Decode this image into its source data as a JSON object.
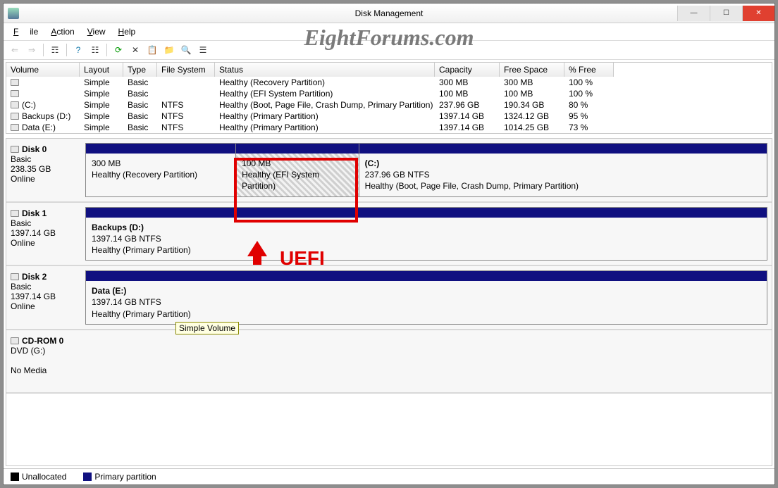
{
  "window": {
    "title": "Disk Management"
  },
  "watermark": "EightForums.com",
  "menu": {
    "file": "File",
    "action": "Action",
    "view": "View",
    "help": "Help"
  },
  "toolbar_icons": [
    "back",
    "forward",
    "up",
    "properties",
    "tree",
    "refresh",
    "delete",
    "create",
    "format",
    "connect",
    "help-bubble",
    "list"
  ],
  "columns": {
    "volume": "Volume",
    "layout": "Layout",
    "type": "Type",
    "fs": "File System",
    "status": "Status",
    "capacity": "Capacity",
    "free": "Free Space",
    "pct": "% Free"
  },
  "volumes": [
    {
      "name": "",
      "layout": "Simple",
      "type": "Basic",
      "fs": "",
      "status": "Healthy (Recovery Partition)",
      "cap": "300 MB",
      "free": "300 MB",
      "pct": "100 %"
    },
    {
      "name": "",
      "layout": "Simple",
      "type": "Basic",
      "fs": "",
      "status": "Healthy (EFI System Partition)",
      "cap": "100 MB",
      "free": "100 MB",
      "pct": "100 %"
    },
    {
      "name": "(C:)",
      "layout": "Simple",
      "type": "Basic",
      "fs": "NTFS",
      "status": "Healthy (Boot, Page File, Crash Dump, Primary Partition)",
      "cap": "237.96 GB",
      "free": "190.34 GB",
      "pct": "80 %"
    },
    {
      "name": "Backups (D:)",
      "layout": "Simple",
      "type": "Basic",
      "fs": "NTFS",
      "status": "Healthy (Primary Partition)",
      "cap": "1397.14 GB",
      "free": "1324.12 GB",
      "pct": "95 %"
    },
    {
      "name": "Data (E:)",
      "layout": "Simple",
      "type": "Basic",
      "fs": "NTFS",
      "status": "Healthy (Primary Partition)",
      "cap": "1397.14 GB",
      "free": "1014.25 GB",
      "pct": "73 %"
    }
  ],
  "disks": [
    {
      "label": "Disk 0",
      "type": "Basic",
      "size": "238.35 GB",
      "state": "Online",
      "parts": [
        {
          "title": "",
          "line1": "300 MB",
          "line2": "Healthy (Recovery Partition)",
          "w": "22"
        },
        {
          "title": "",
          "line1": "100 MB",
          "line2": "Healthy (EFI System Partition)",
          "w": "18",
          "hatch": true
        },
        {
          "title": "(C:)",
          "line1": "237.96 GB NTFS",
          "line2": "Healthy (Boot, Page File, Crash Dump, Primary Partition)",
          "w": "60"
        }
      ]
    },
    {
      "label": "Disk 1",
      "type": "Basic",
      "size": "1397.14 GB",
      "state": "Online",
      "parts": [
        {
          "title": "Backups  (D:)",
          "line1": "1397.14 GB NTFS",
          "line2": "Healthy (Primary Partition)",
          "w": "100"
        }
      ]
    },
    {
      "label": "Disk 2",
      "type": "Basic",
      "size": "1397.14 GB",
      "state": "Online",
      "parts": [
        {
          "title": "Data  (E:)",
          "line1": "1397.14 GB NTFS",
          "line2": "Healthy (Primary Partition)",
          "w": "100"
        }
      ]
    },
    {
      "label": "CD-ROM 0",
      "type": "DVD (G:)",
      "size": "",
      "state": "No Media",
      "parts": []
    }
  ],
  "tooltip": "Simple Volume",
  "legend": {
    "unalloc": "Unallocated",
    "primary": "Primary partition"
  },
  "annotation": {
    "uefi": "UEFI"
  }
}
